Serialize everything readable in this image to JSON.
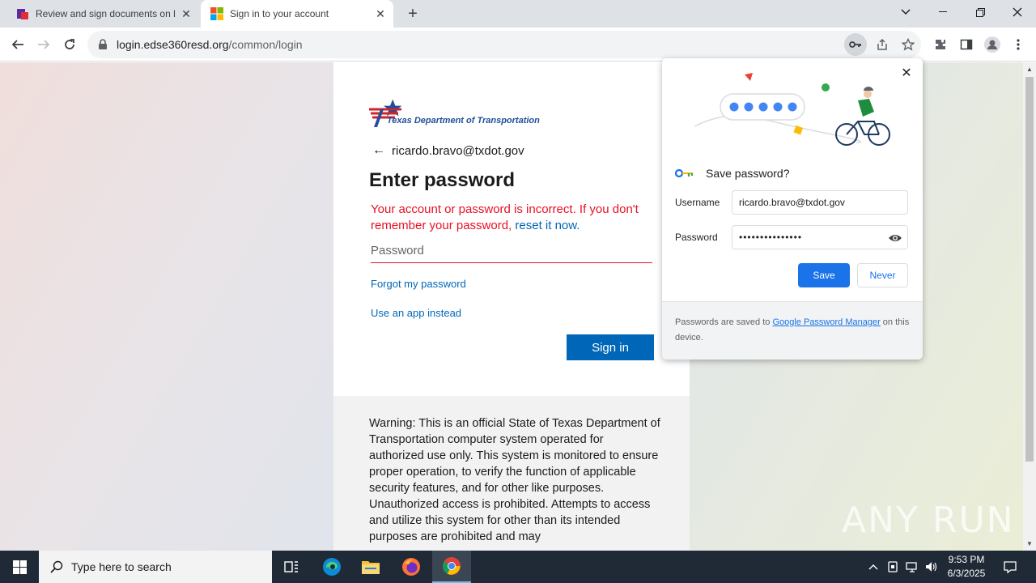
{
  "browser": {
    "tabs": [
      {
        "title": "Review and sign documents on l",
        "active": false
      },
      {
        "title": "Sign in to your account",
        "active": true
      }
    ],
    "url_host": "login.edse360resd.org",
    "url_path": "/common/login"
  },
  "page": {
    "logo_text": "Texas Department of Transportation",
    "identity": "ricardo.bravo@txdot.gov",
    "heading": "Enter password",
    "error_text": "Your account or password is incorrect. If you don't remember your password, ",
    "error_link": "reset it now.",
    "password_placeholder": "Password",
    "forgot_link": "Forgot my password",
    "app_link": "Use an app instead",
    "signin_label": "Sign in",
    "warning": "Warning: This is an official State of Texas Department of Transportation computer system operated for authorized use only. This system is monitored to ensure proper operation, to verify the function of applicable security features, and for other like purposes. Unauthorized access is prohibited. Attempts to access and utilize this system for other than its intended purposes are prohibited and may"
  },
  "popup": {
    "title": "Save password?",
    "username_label": "Username",
    "username_value": "ricardo.bravo@txdot.gov",
    "password_label": "Password",
    "password_value": "•••••••••••••••",
    "save_label": "Save",
    "never_label": "Never",
    "footer_prefix": "Passwords are saved to ",
    "footer_link": "Google Password Manager",
    "footer_suffix": " on this device."
  },
  "watermark": "ANY RUN",
  "taskbar": {
    "search_placeholder": "Type here to search",
    "time": "9:53 PM",
    "date": "6/3/2025"
  },
  "colors": {
    "accent_ms": "#0067b8",
    "error": "#e81123",
    "chrome_blue": "#1a73e8"
  }
}
